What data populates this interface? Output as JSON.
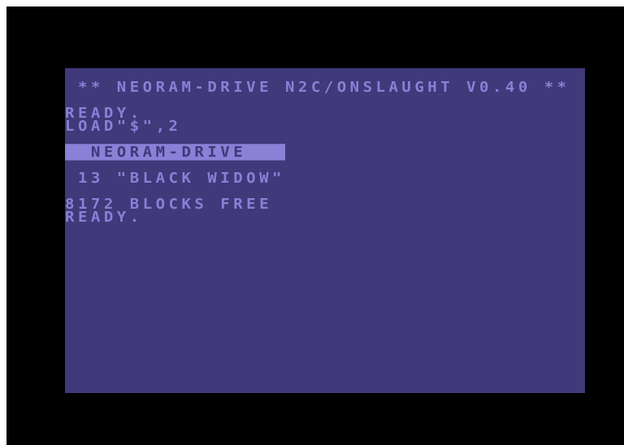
{
  "screen": {
    "banner": " ** NEORAM-DRIVE N2C/ONSLAUGHT V0.40 **",
    "ready_1": "READY.",
    "command": "LOAD\"$\",2",
    "directory": {
      "header_text": "  NEORAM-DRIVE   ",
      "entry": " 13 \"BLACK WIDOW\"",
      "blocks_free": "8172 BLOCKS FREE"
    },
    "ready_2": "READY."
  },
  "colors": {
    "border": "#000000",
    "background": "#40397a",
    "text": "#8a80d6"
  }
}
